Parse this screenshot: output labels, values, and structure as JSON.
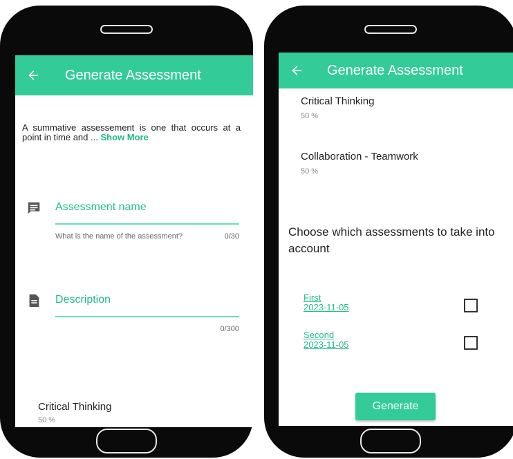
{
  "left_screen": {
    "appbar": {
      "title": "Generate Assessment"
    },
    "intro_text": "A summative assessement is one that occurs at a point in time and ...",
    "show_more": "Show More",
    "assessment_name": {
      "label": "Assessment name",
      "helper": "What is the name of the assessment?",
      "counter": "0/30"
    },
    "description": {
      "label": "Description",
      "counter": "0/300"
    },
    "skills": [
      {
        "name": "Critical Thinking",
        "percent": "50 %"
      }
    ]
  },
  "right_screen": {
    "appbar": {
      "title": "Generate Assessment"
    },
    "skills": [
      {
        "name": "Critical Thinking",
        "percent": "50 %"
      },
      {
        "name": "Collaboration - Teamwork",
        "percent": "50 %"
      }
    ],
    "choose_heading": "Choose which assessments to take into account",
    "assessments": [
      {
        "name": "First",
        "date": "2023-11-05",
        "checked": false
      },
      {
        "name": "Second",
        "date": "2023-11-05",
        "checked": false
      }
    ],
    "generate_button": "Generate"
  },
  "colors": {
    "accent": "#33cc99",
    "accent_text": "#22bb88",
    "phone_body": "#0a0a0a"
  },
  "icons": {
    "back": "arrow-left-icon",
    "assessment_name": "message-icon",
    "description": "document-icon"
  }
}
